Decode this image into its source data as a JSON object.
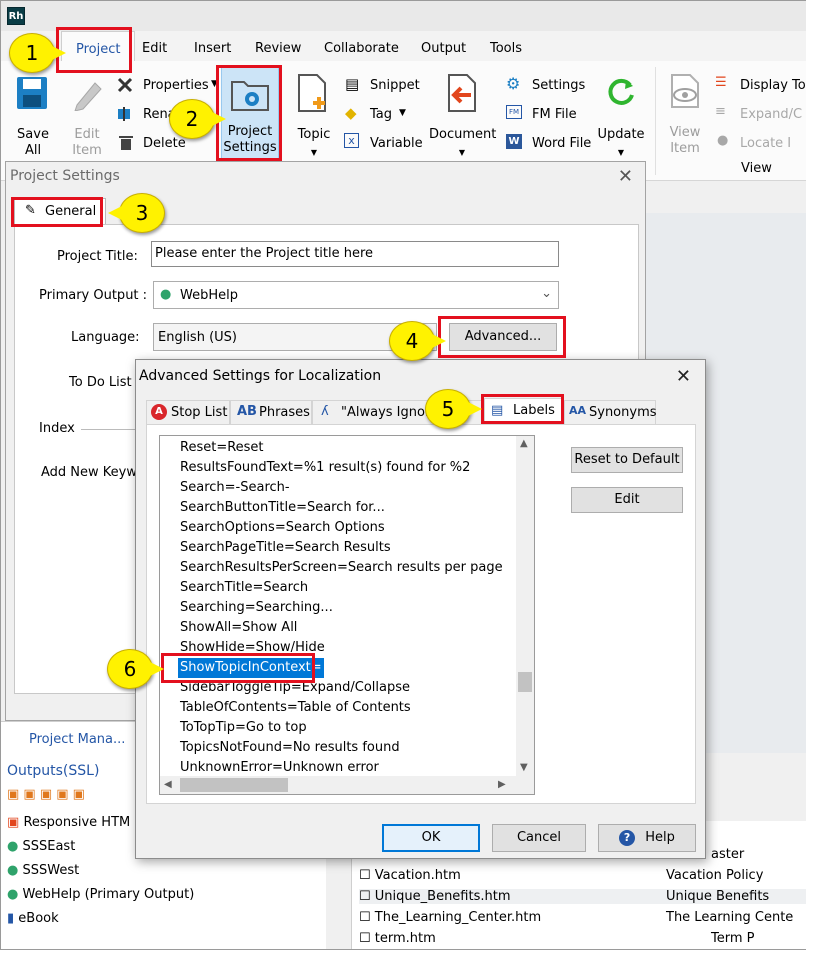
{
  "app": {
    "logo": "Rh"
  },
  "menu": {
    "tabs": [
      "Project",
      "Edit",
      "Insert",
      "Review",
      "Collaborate",
      "Output",
      "Tools"
    ],
    "active": "Project"
  },
  "ribbon": {
    "save_all": "Save\nAll",
    "edit_item": "Edit\nItem",
    "properties": "Properties",
    "rename": "Rena",
    "delete": "Delete",
    "project_settings": "Project\nSettings",
    "topic": "Topic",
    "snippet": "Snippet",
    "tag": "Tag",
    "variable": "Variable",
    "document": "Document",
    "settings": "Settings",
    "fm_file": "FM File",
    "word_file": "Word File",
    "update": "Update",
    "view_item": "View\nItem",
    "display_to": "Display To",
    "expand": "Expand/C",
    "locate": "Locate I",
    "view_group": "View"
  },
  "callouts": [
    "1",
    "2",
    "3",
    "4",
    "5",
    "6"
  ],
  "project_settings": {
    "title": "Project Settings",
    "tab": "General",
    "project_title_label": "Project Title:",
    "project_title_value": "Please enter the Project title here",
    "primary_output_label": "Primary Output :",
    "primary_output_value": "WebHelp",
    "language_label": "Language:",
    "language_value": "English (US)",
    "advanced_button": "Advanced...",
    "todo_label": "To Do List",
    "index_label": "Index",
    "add_keyword_label": "Add New Keywo"
  },
  "advanced": {
    "title": "Advanced Settings for Localization",
    "tabs": [
      "Stop List",
      "Phrases",
      "\"Always Ignor",
      "Labels",
      "Synonyms"
    ],
    "active_tab": "Labels",
    "items": [
      "Reset=Reset",
      "ResultsFoundText=%1 result(s) found for %2",
      "Search=-Search-",
      "SearchButtonTitle=Search for...",
      "SearchOptions=Search Options",
      "SearchPageTitle=Search Results",
      "SearchResultsPerScreen=Search results per page",
      "SearchTitle=Search",
      "Searching=Searching...",
      "ShowAll=Show All",
      "ShowHide=Show/Hide",
      "ShowTopicInContext=",
      "SidebarToggleTip=Expand/Collapse",
      "TableOfContents=Table of Contents",
      "ToTopTip=Go to top",
      "TopicsNotFound=No results found",
      "UnknownError=Unknown error"
    ],
    "selected_item": "ShowTopicInContext=",
    "reset_button": "Reset to Default",
    "edit_button": "Edit",
    "ok_button": "OK",
    "cancel_button": "Cancel",
    "help_button": "Help"
  },
  "background": {
    "project_manager": "Project Mana...",
    "outputs_header": "Outputs(SSL)",
    "outputs": [
      "Responsive HTM",
      "SSSEast",
      "SSSWest",
      "WebHelp (Primary Output)",
      "eBook"
    ],
    "files": [
      {
        "name": "",
        "title": "aster"
      },
      {
        "name": "Vacation.htm",
        "title": "Vacation Policy"
      },
      {
        "name": "Unique_Benefits.htm",
        "title": "Unique Benefits"
      },
      {
        "name": "The_Learning_Center.htm",
        "title": "The Learning Cente"
      },
      {
        "name": "term.htm",
        "title": "Term P"
      }
    ]
  },
  "colors": {
    "highlight": "#e3101e",
    "callout": "#fff200",
    "selection": "#0078d7",
    "accent_blue": "#2456a6"
  }
}
